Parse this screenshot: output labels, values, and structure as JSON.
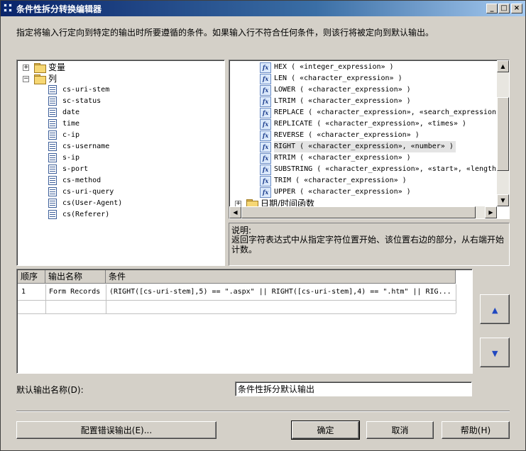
{
  "window": {
    "title": "条件性拆分转换编辑器",
    "controls": {
      "minimize": "_",
      "maximize": "□",
      "close": "×"
    }
  },
  "instructions": "指定将输入行定向到特定的输出时所要遵循的条件。如果输入行不符合任何条件，则该行将被定向到默认输出。",
  "left_tree": {
    "variables": {
      "label": "变量",
      "expander": "+"
    },
    "columns": {
      "label": "列",
      "expander": "−"
    },
    "column_items": [
      "cs-uri-stem",
      "sc-status",
      "date",
      "time",
      "c-ip",
      "cs-username",
      "s-ip",
      "s-port",
      "cs-method",
      "cs-uri-query",
      "cs(User-Agent)",
      "cs(Referer)"
    ]
  },
  "right_tree": {
    "functions": [
      {
        "name": "HEX",
        "args": "( «integer_expression» )"
      },
      {
        "name": "LEN",
        "args": "( «character_expression» )"
      },
      {
        "name": "LOWER",
        "args": "( «character_expression» )"
      },
      {
        "name": "LTRIM",
        "args": "( «character_expression» )"
      },
      {
        "name": "REPLACE",
        "args": "( «character_expression», «search_expression», «"
      },
      {
        "name": "REPLICATE",
        "args": "( «character_expression», «times» )"
      },
      {
        "name": "REVERSE",
        "args": "( «character_expression» )"
      },
      {
        "name": "RIGHT",
        "args": "( «character_expression», «number» )"
      },
      {
        "name": "RTRIM",
        "args": "( «character_expression» )"
      },
      {
        "name": "SUBSTRING",
        "args": "( «character_expression», «start», «length» )"
      },
      {
        "name": "TRIM",
        "args": "( «character_expression» )"
      },
      {
        "name": "UPPER",
        "args": "( «character_expression» )"
      }
    ],
    "selected_index": 7,
    "fx_label": "fx",
    "datetime_folder": {
      "label": "日期/时间函数",
      "expander": "+"
    }
  },
  "description": {
    "label": "说明:",
    "text": "返回字符表达式中从指定字符位置开始、该位置右边的部分，从右端开始计数。"
  },
  "conditions_grid": {
    "headers": [
      "顺序",
      "输出名称",
      "条件"
    ],
    "rows": [
      {
        "order": "1",
        "name": "Form Records",
        "condition": "(RIGHT([cs-uri-stem],5) == \".aspx\" || RIGHT([cs-uri-stem],4) == \".htm\" || RIG..."
      }
    ]
  },
  "move_buttons": {
    "up": "▲",
    "down": "▼"
  },
  "default_output": {
    "label": "默认输出名称(D):",
    "value": "条件性拆分默认输出"
  },
  "buttons": {
    "configure_error": "配置错误输出(E)...",
    "ok": "确定",
    "cancel": "取消",
    "help": "帮助(H)"
  }
}
